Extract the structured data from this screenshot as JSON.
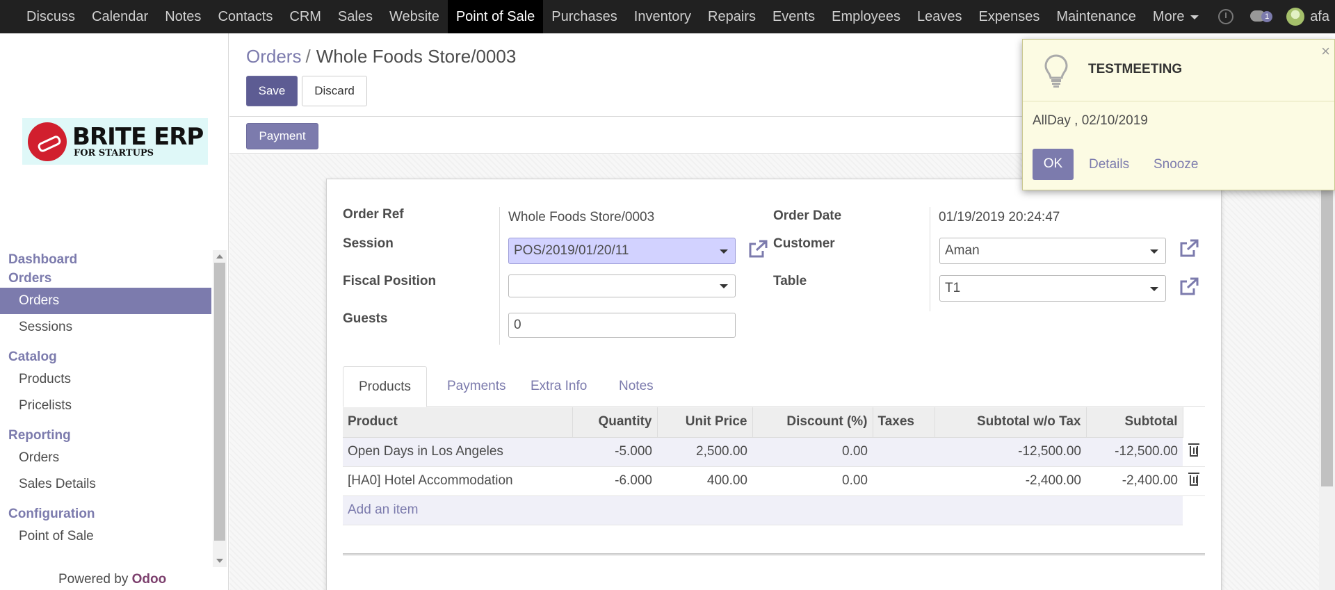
{
  "topbar": {
    "menu": [
      "Discuss",
      "Calendar",
      "Notes",
      "Contacts",
      "CRM",
      "Sales",
      "Website",
      "Point of Sale",
      "Purchases",
      "Inventory",
      "Repairs",
      "Events",
      "Employees",
      "Leaves",
      "Expenses",
      "Maintenance",
      "More"
    ],
    "active": "Point of Sale",
    "chat_badge": "1",
    "user": "afa"
  },
  "logo": {
    "brand": "BRITE ERP",
    "tagline": "FOR STARTUPS"
  },
  "sidebar": {
    "sections": [
      {
        "heading": "Dashboard",
        "items": []
      },
      {
        "heading": "Orders",
        "items": [
          "Orders",
          "Sessions"
        ]
      },
      {
        "heading": "Catalog",
        "items": [
          "Products",
          "Pricelists"
        ]
      },
      {
        "heading": "Reporting",
        "items": [
          "Orders",
          "Sales Details"
        ]
      },
      {
        "heading": "Configuration",
        "items": [
          "Point of Sale"
        ]
      }
    ],
    "active_item": "Orders",
    "powered_by": "Powered by",
    "powered_brand": "Odoo"
  },
  "control": {
    "breadcrumb_parent": "Orders",
    "breadcrumb_sep": "/",
    "breadcrumb_current": "Whole Foods Store/0003",
    "save_label": "Save",
    "discard_label": "Discard",
    "payment_label": "Payment"
  },
  "form": {
    "order_ref_label": "Order Ref",
    "order_ref": "Whole Foods Store/0003",
    "session_label": "Session",
    "session": "POS/2019/01/20/11",
    "fiscal_position_label": "Fiscal Position",
    "fiscal_position": "",
    "guests_label": "Guests",
    "guests": "0",
    "order_date_label": "Order Date",
    "order_date": "01/19/2019 20:24:47",
    "customer_label": "Customer",
    "customer": "Aman",
    "table_label": "Table",
    "table": "T1"
  },
  "tabs": [
    "Products",
    "Payments",
    "Extra Info",
    "Notes"
  ],
  "active_tab": "Products",
  "lines": {
    "columns": [
      "Product",
      "Quantity",
      "Unit Price",
      "Discount (%)",
      "Taxes",
      "Subtotal w/o Tax",
      "Subtotal"
    ],
    "rows": [
      {
        "product": "Open Days in Los Angeles",
        "quantity": "-5.000",
        "unit_price": "2,500.00",
        "discount": "0.00",
        "taxes": "",
        "subtotal_wo_tax": "-12,500.00",
        "subtotal": "-12,500.00"
      },
      {
        "product": "[HA0] Hotel Accommodation",
        "quantity": "-6.000",
        "unit_price": "400.00",
        "discount": "0.00",
        "taxes": "",
        "subtotal_wo_tax": "-2,400.00",
        "subtotal": "-2,400.00"
      }
    ],
    "add_item": "Add an item"
  },
  "notification": {
    "title": "TESTMEETING",
    "body": "AllDay , 02/10/2019",
    "ok_label": "OK",
    "details_label": "Details",
    "snooze_label": "Snooze",
    "close": "×"
  },
  "colors": {
    "primary": "#7c7bad",
    "topbar": "#212121",
    "notification_bg": "#fcfbe3"
  }
}
